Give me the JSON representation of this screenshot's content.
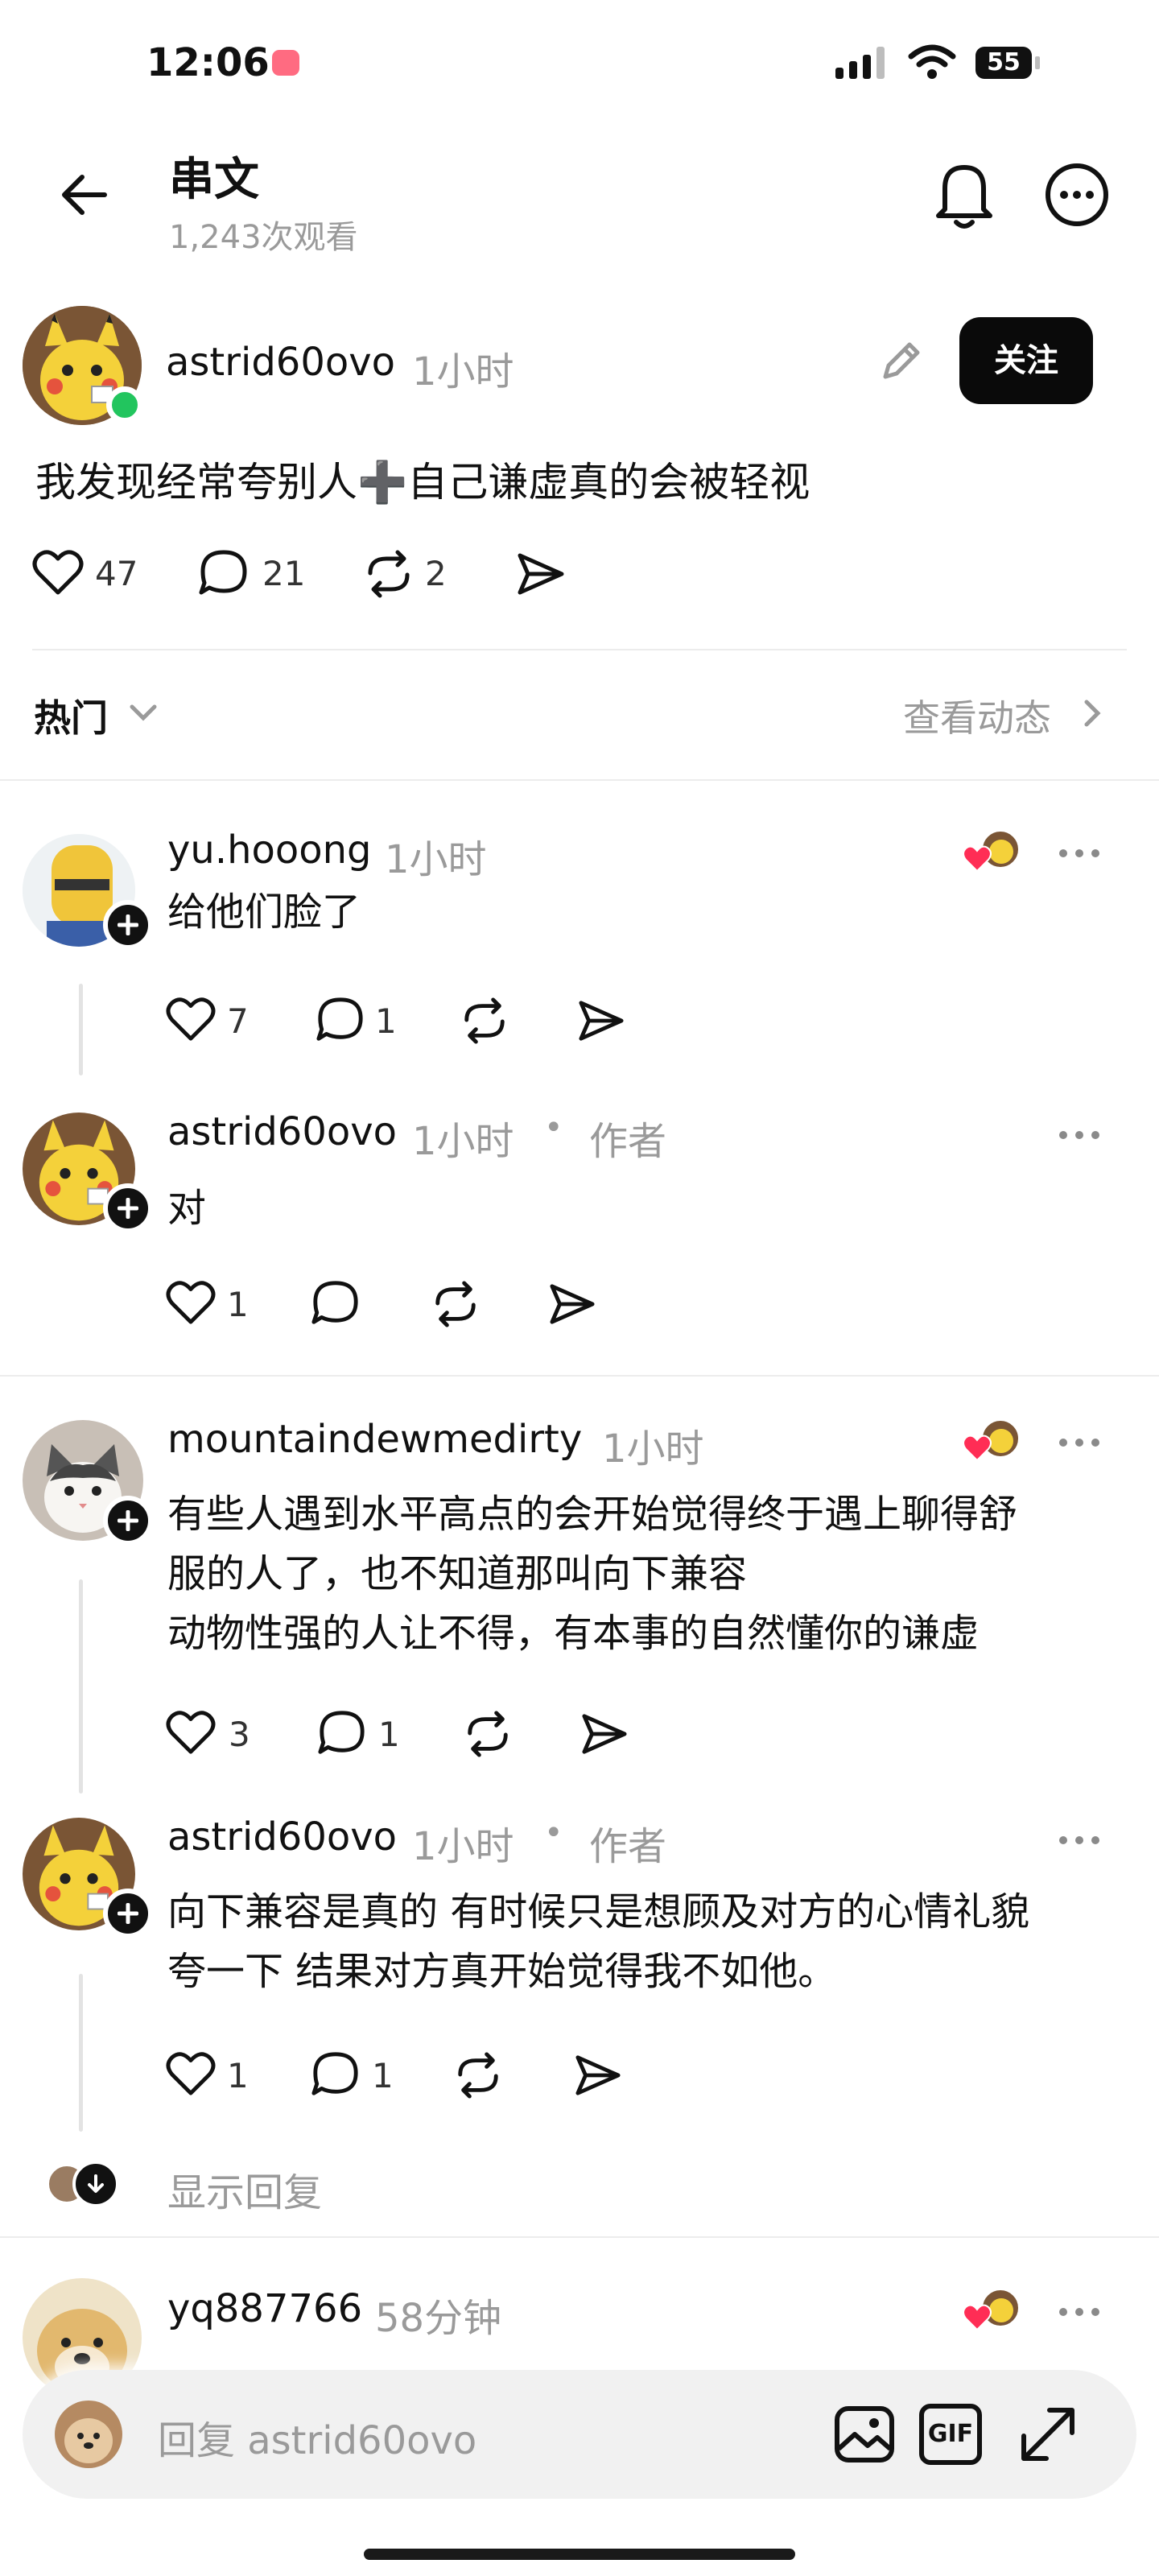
{
  "status_bar": {
    "time": "12:06",
    "battery": "55"
  },
  "header": {
    "title": "串文",
    "views": "1,243次观看"
  },
  "post": {
    "username": "astrid60ovo",
    "time": "1小时",
    "follow_label": "关注",
    "text": "我发现经常夸别人➕自己谦虚真的会被轻视",
    "likes": "47",
    "comments": "21",
    "reposts": "2"
  },
  "filter": {
    "sort_label": "热门",
    "activity_label": "查看动态"
  },
  "replies": [
    {
      "username": "yu.hooong",
      "time": "1小时",
      "text": "给他们脸了",
      "likes": "7",
      "comments": "1"
    },
    {
      "username": "astrid60ovo",
      "time": "1小时",
      "dot": "•",
      "author_label": "作者",
      "text": "对",
      "likes": "1",
      "comments": ""
    },
    {
      "username": "mountaindewmedirty",
      "time": "1小时",
      "lines": [
        "有些人遇到水平高点的会开始觉得终于遇上聊得舒",
        "服的人了，也不知道那叫向下兼容",
        "动物性强的人让不得，有本事的自然懂你的谦虚"
      ],
      "likes": "3",
      "comments": "1"
    },
    {
      "username": "astrid60ovo",
      "time": "1小时",
      "dot": "•",
      "author_label": "作者",
      "lines": [
        "向下兼容是真的 有时候只是想顾及对方的心情礼貌",
        "夸一下 结果对方真开始觉得我不如他。"
      ],
      "likes": "1",
      "comments": "1"
    },
    {
      "username": "yq887766",
      "time": "58分钟"
    }
  ],
  "show_replies_label": "显示回复",
  "composer": {
    "placeholder": "回复 astrid60ovo",
    "gif_label": "GIF"
  },
  "colors": {
    "like_red": "#ff2d55",
    "online_green": "#22c55e",
    "pikachu_yellow": "#f4d13a"
  }
}
